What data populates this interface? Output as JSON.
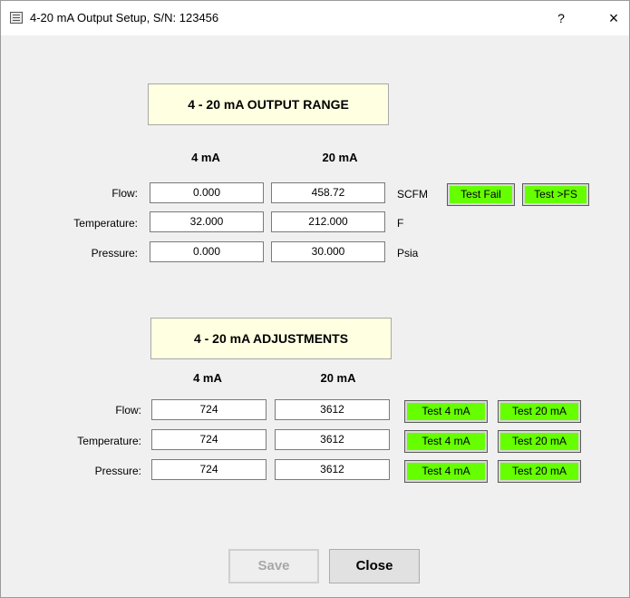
{
  "window": {
    "title": "4-20 mA Output Setup, S/N: 123456",
    "help_label": "?",
    "close_label": "×"
  },
  "range": {
    "title": "4 - 20 mA OUTPUT RANGE",
    "col_4ma": "4 mA",
    "col_20ma": "20 mA",
    "rows": [
      {
        "label": "Flow:",
        "low": "0.000",
        "high": "458.72",
        "unit": "SCFM"
      },
      {
        "label": "Temperature:",
        "low": "32.000",
        "high": "212.000",
        "unit": "F"
      },
      {
        "label": "Pressure:",
        "low": "0.000",
        "high": "30.000",
        "unit": "Psia"
      }
    ],
    "test_fail_label": "Test Fail",
    "test_fs_label": "Test >FS"
  },
  "adjust": {
    "title": "4 - 20 mA ADJUSTMENTS",
    "col_4ma": "4 mA",
    "col_20ma": "20 mA",
    "rows": [
      {
        "label": "Flow:",
        "low": "724",
        "high": "3612",
        "test4": "Test 4 mA",
        "test20": "Test 20 mA"
      },
      {
        "label": "Temperature:",
        "low": "724",
        "high": "3612",
        "test4": "Test 4 mA",
        "test20": "Test 20 mA"
      },
      {
        "label": "Pressure:",
        "low": "724",
        "high": "3612",
        "test4": "Test 4 mA",
        "test20": "Test 20 mA"
      }
    ]
  },
  "buttons": {
    "save_label": "Save",
    "close_label": "Close"
  },
  "colors": {
    "test_button_bg": "#66ff00",
    "section_title_bg": "#ffffe1"
  }
}
